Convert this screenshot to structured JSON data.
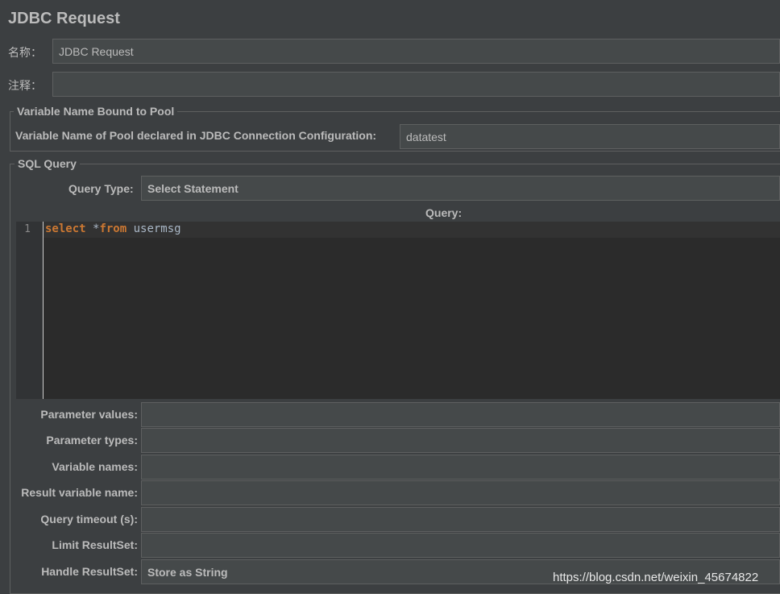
{
  "window": {
    "title": "JDBC Request"
  },
  "name": {
    "label": "名称：",
    "value": "JDBC Request"
  },
  "comments": {
    "label": "注释：",
    "value": ""
  },
  "pool_section": {
    "legend": "Variable Name Bound to Pool",
    "pool_label": "Variable Name of Pool declared in JDBC Connection Configuration:",
    "pool_value": "datatest"
  },
  "sql_section": {
    "legend": "SQL Query",
    "query_type_label": "Query Type:",
    "query_type_value": "Select Statement",
    "query_label": "Query:",
    "editor": {
      "line_number": "1",
      "kw_select": "select",
      "text_star": " *",
      "kw_from": "from",
      "text_table": " usermsg"
    },
    "params": [
      {
        "label": "Parameter values:",
        "value": ""
      },
      {
        "label": "Parameter types:",
        "value": ""
      },
      {
        "label": "Variable names:",
        "value": ""
      },
      {
        "label": "Result variable name:",
        "value": ""
      },
      {
        "label": "Query timeout (s):",
        "value": ""
      },
      {
        "label": "Limit ResultSet:",
        "value": ""
      },
      {
        "label": "Handle ResultSet:",
        "value": "Store as String"
      }
    ]
  },
  "watermark": "https://blog.csdn.net/weixin_45674822",
  "colors": {
    "background": "#3c3f41",
    "field": "#45494a",
    "editor": "#2b2b2b",
    "keyword": "#cc7832"
  }
}
